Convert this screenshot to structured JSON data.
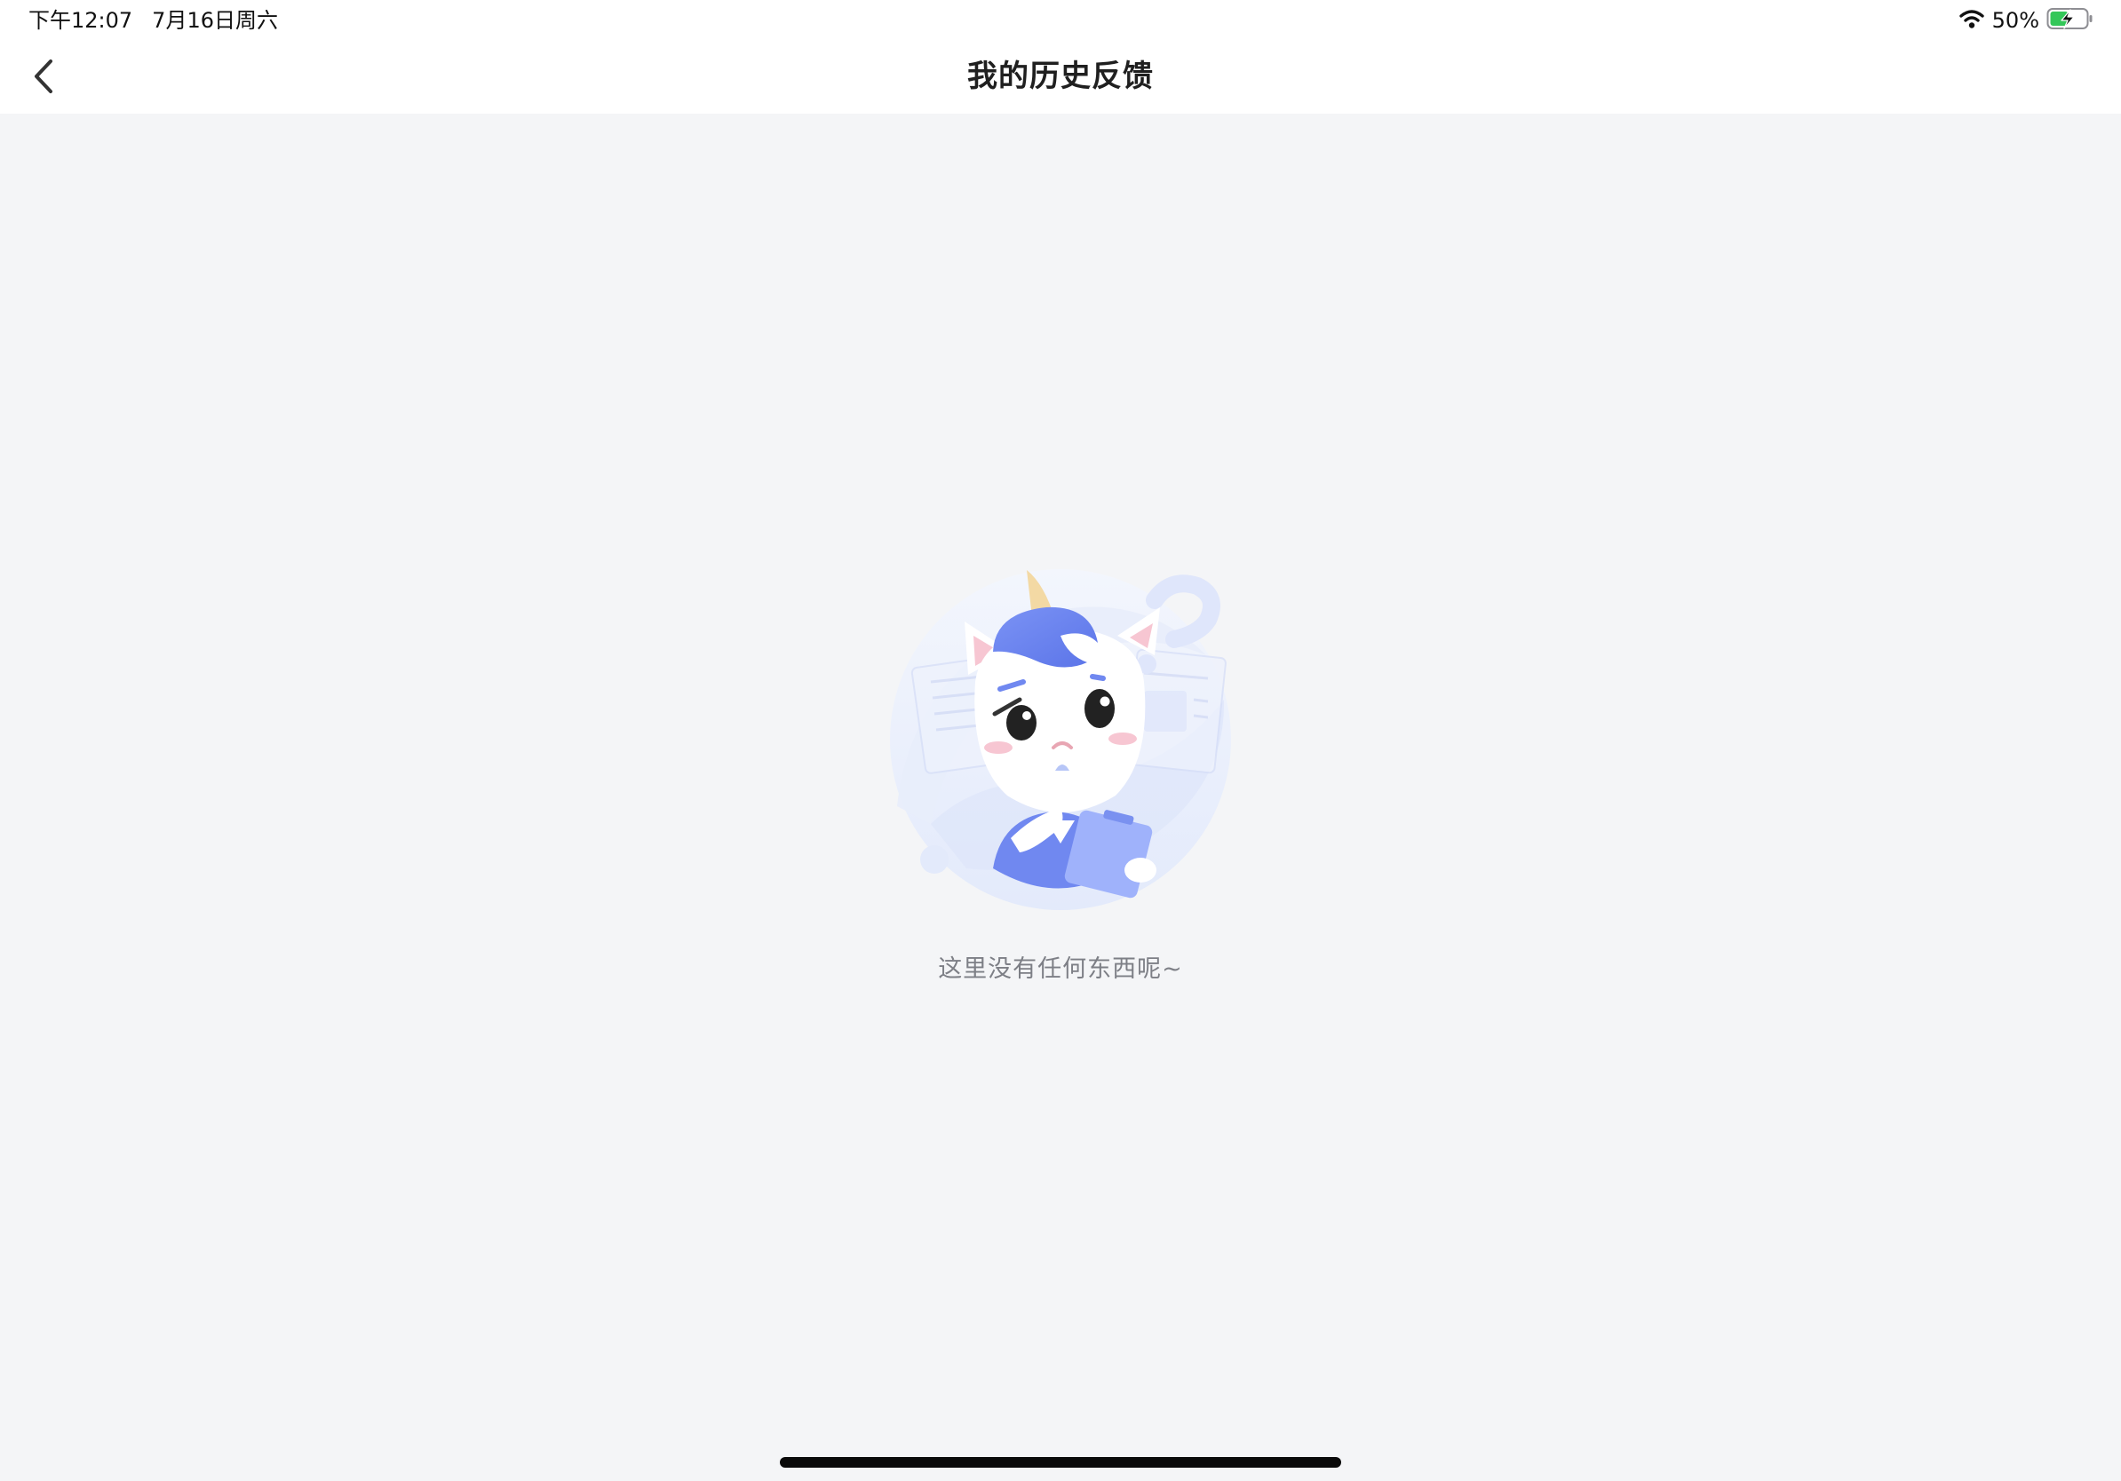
{
  "status_bar": {
    "time": "下午12:07",
    "date": "7月16日周六",
    "battery_percent": "50%",
    "wifi_icon": "wifi-icon",
    "battery_icon": "battery-charging-icon"
  },
  "nav": {
    "back_icon": "chevron-left-icon",
    "title": "我的历史反馈"
  },
  "empty_state": {
    "illustration": "unicorn-mascot-with-question-mark",
    "message": "这里没有任何东西呢~"
  },
  "colors": {
    "background": "#f4f5f7",
    "header_background": "#ffffff",
    "accent_blue": "#6b8cf0",
    "text_secondary": "#7d7f86"
  }
}
